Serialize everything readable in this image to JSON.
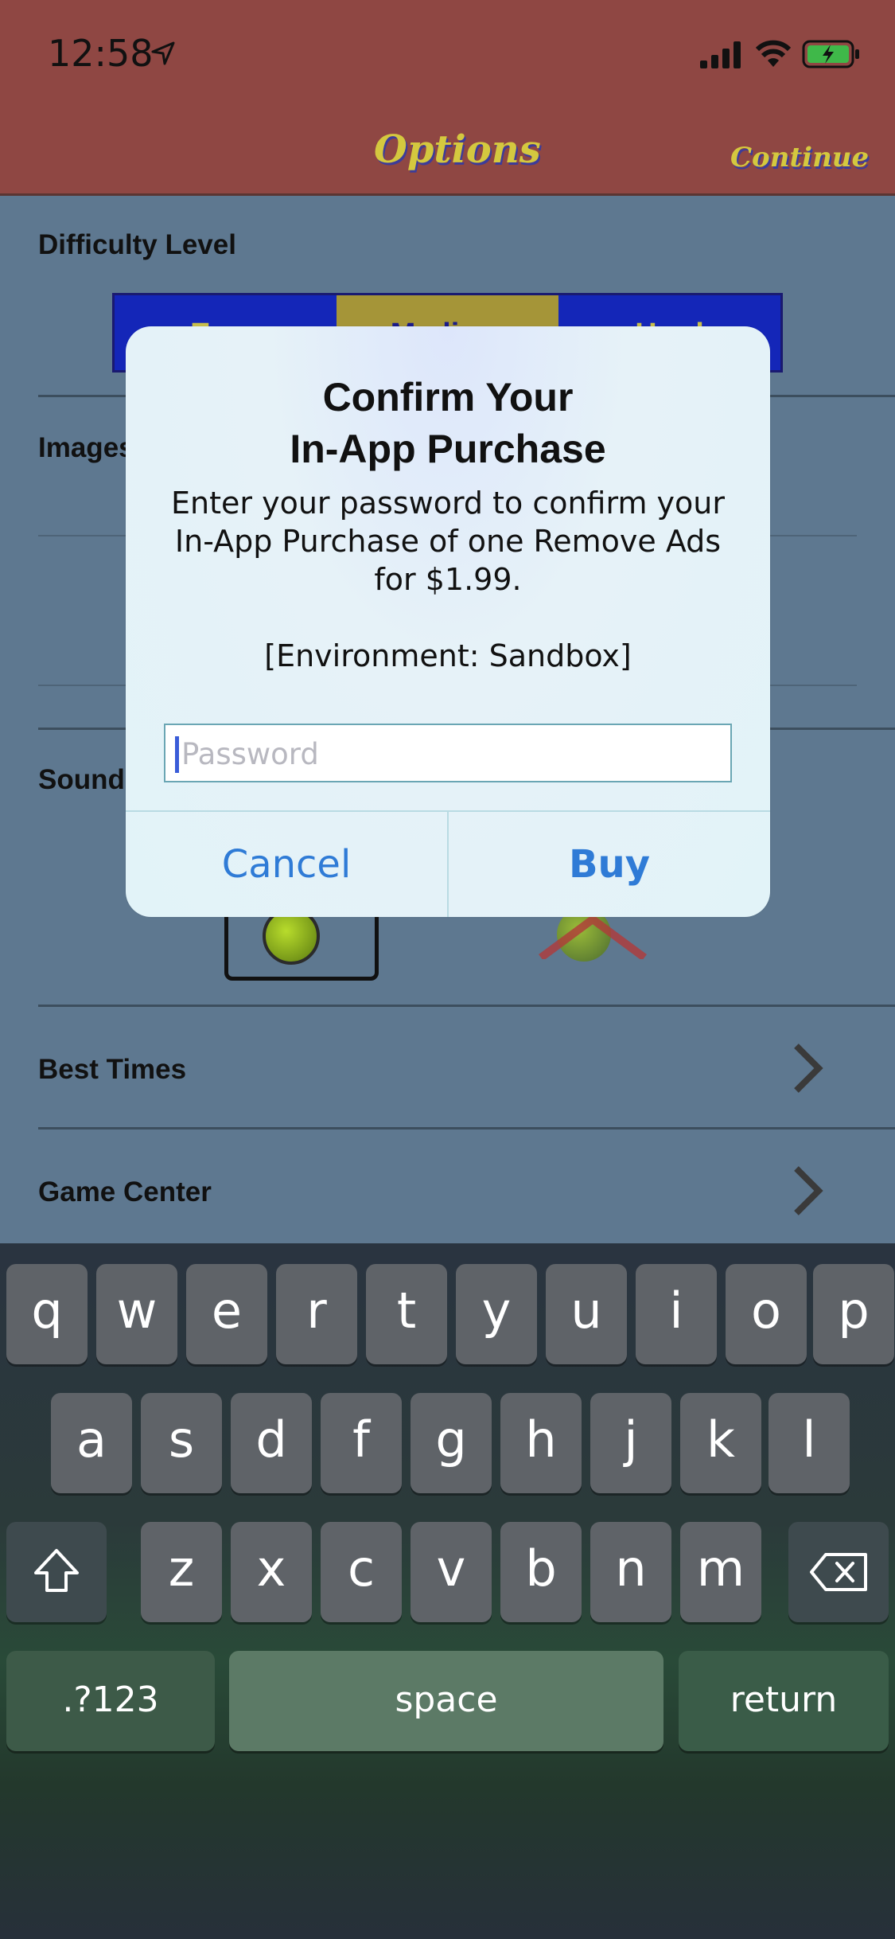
{
  "status_bar": {
    "time": "12:58"
  },
  "nav": {
    "title": "Options",
    "continue_label": "Continue"
  },
  "options": {
    "difficulty_label": "Difficulty Level",
    "difficulty_segments": [
      "Easy",
      "Medium",
      "Hard"
    ],
    "difficulty_selected": "Medium",
    "image_label": "Images",
    "sound_label": "Sound",
    "best_times_label": "Best Times",
    "game_center_label": "Game Center"
  },
  "dialog": {
    "title_line1": "Confirm Your",
    "title_line2": "In-App Purchase",
    "body_line1": "Enter your password to confirm your",
    "body_line2": "In-App Purchase of one Remove Ads",
    "body_line3": "for $1.99.",
    "environment": "[Environment: Sandbox]",
    "password_placeholder": "Password",
    "password_value": "",
    "cancel_label": "Cancel",
    "buy_label": "Buy"
  },
  "keyboard": {
    "row1": [
      "q",
      "w",
      "e",
      "r",
      "t",
      "y",
      "u",
      "i",
      "o",
      "p"
    ],
    "row2": [
      "a",
      "s",
      "d",
      "f",
      "g",
      "h",
      "j",
      "k",
      "l"
    ],
    "row3": [
      "z",
      "x",
      "c",
      "v",
      "b",
      "n",
      "m"
    ],
    "numbers_label": ".?123",
    "space_label": "space",
    "return_label": "return"
  },
  "colors": {
    "nav_bar": "#8f4743",
    "background": "#5e7890",
    "accent_blue": "#2f7bd6",
    "title_yellow": "#d4c83f"
  }
}
